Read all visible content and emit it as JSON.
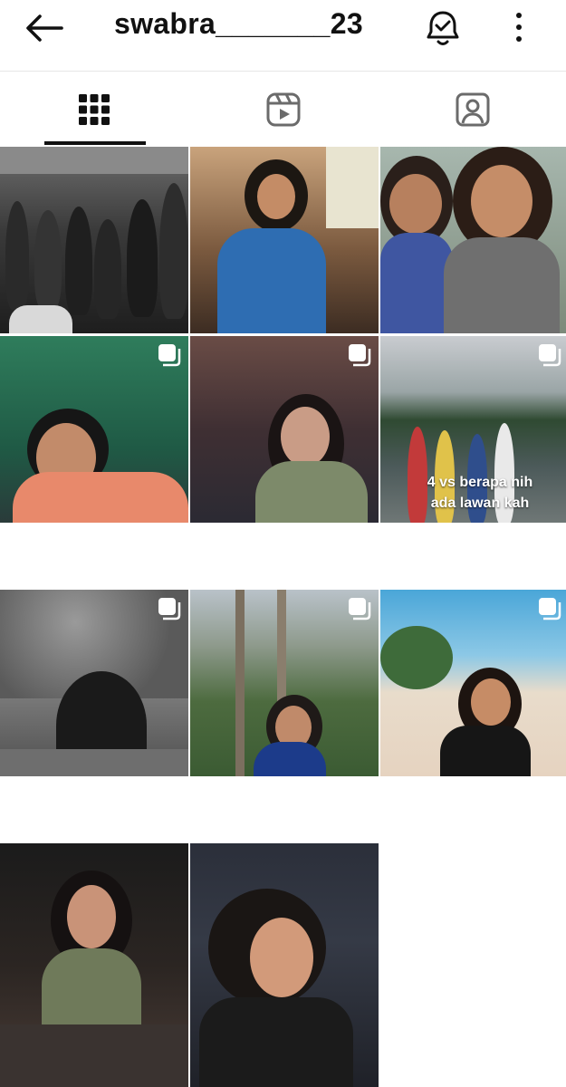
{
  "header": {
    "username": "swabra_______23",
    "back_icon": "arrow-left-icon",
    "notify_icon": "bell-check-icon",
    "more_icon": "more-vertical-icon"
  },
  "tabs": [
    {
      "name": "posts-grid",
      "icon": "grid-icon",
      "selected": true
    },
    {
      "name": "reels",
      "icon": "reels-icon",
      "selected": false
    },
    {
      "name": "tagged",
      "icon": "tagged-person-icon",
      "selected": false
    }
  ],
  "posts": [
    {
      "id": 1,
      "multi": false
    },
    {
      "id": 2,
      "multi": false
    },
    {
      "id": 3,
      "multi": false
    },
    {
      "id": 4,
      "multi": true
    },
    {
      "id": 5,
      "multi": true
    },
    {
      "id": 6,
      "multi": true,
      "caption": "4 vs berapa nih ada lawan kah"
    },
    {
      "id": 7,
      "multi": true
    },
    {
      "id": 8,
      "multi": true
    },
    {
      "id": 9,
      "multi": true
    },
    {
      "id": 10,
      "multi": false
    },
    {
      "id": 11,
      "multi": false
    }
  ],
  "colors": {
    "accent": "#111111",
    "divider": "#e6e6e6"
  }
}
